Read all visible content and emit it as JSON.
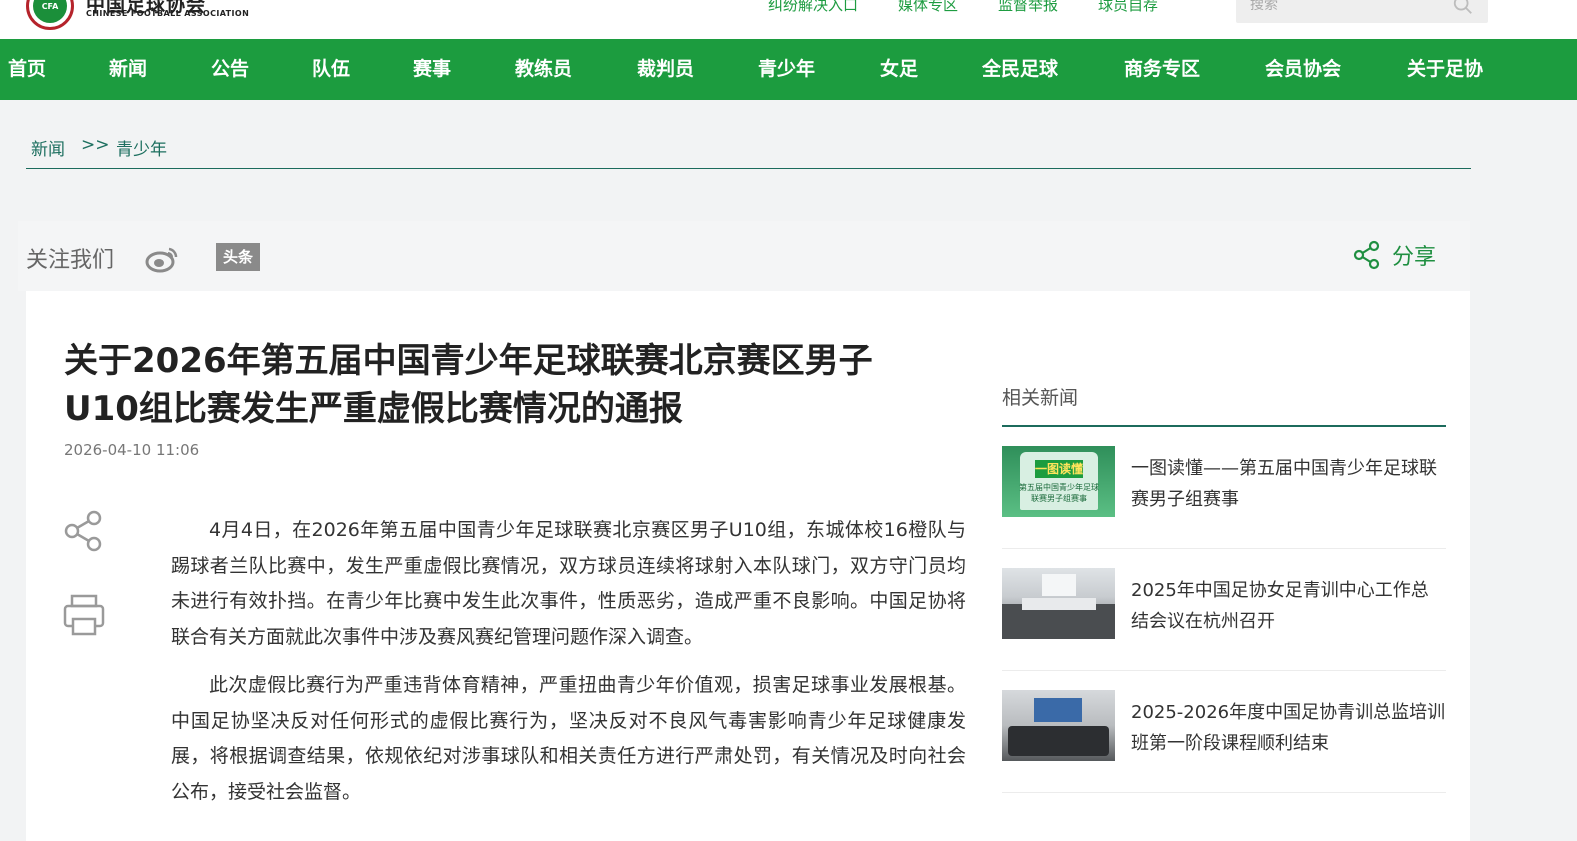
{
  "header": {
    "logo_text": "中国足球协会",
    "logo_en": "CHINESE FOOTBALL ASSOCIATION",
    "logo_badge": "CFA",
    "top_links": [
      "纠纷解决入口",
      "媒体专区",
      "监督举报",
      "球员自荐"
    ],
    "search_placeholder": "搜索"
  },
  "nav": {
    "items": [
      "首页",
      "新闻",
      "公告",
      "队伍",
      "赛事",
      "教练员",
      "裁判员",
      "青少年",
      "女足",
      "全民足球",
      "商务专区",
      "会员协会",
      "关于足协"
    ]
  },
  "breadcrumb": {
    "first": "新闻",
    "separator": ">>",
    "second": "青少年"
  },
  "follow": {
    "label": "关注我们",
    "toutiao_label": "头条",
    "share_label": "分享"
  },
  "article": {
    "title": "关于2026年第五届中国青少年足球联赛北京赛区男子U10组比赛发生严重虚假比赛情况的通报",
    "date": "2026-04-10 11:06",
    "paragraphs": [
      "4月4日，在2026年第五届中国青少年足球联赛北京赛区男子U10组，东城体校16橙队与踢球者兰队比赛中，发生严重虚假比赛情况，双方球员连续将球射入本队球门，双方守门员均未进行有效扑挡。在青少年比赛中发生此次事件，性质恶劣，造成严重不良影响。中国足协将联合有关方面就此次事件中涉及赛风赛纪管理问题作深入调查。",
      "此次虚假比赛行为严重违背体育精神，严重扭曲青少年价值观，损害足球事业发展根基。中国足协坚决反对任何形式的虚假比赛行为，坚决反对不良风气毒害影响青少年足球健康发展，将根据调查结果，依规依纪对涉事球队和相关责任方进行严肃处罚，有关情况及时向社会公布，接受社会监督。"
    ]
  },
  "related": {
    "title": "相关新闻",
    "items": [
      {
        "text": "一图读懂——第五届中国青少年足球联赛男子组赛事",
        "thumb_caption": "一图读懂",
        "thumb_sub": "第五届中国青少年足球联赛男子组赛事"
      },
      {
        "text": "2025年中国足协女足青训中心工作总结会议在杭州召开"
      },
      {
        "text": "2025-2026年度中国足协青训总监培训班第一阶段课程顺利结束"
      }
    ]
  },
  "colors": {
    "brand_green": "#1c9c3f",
    "line_teal": "#1c6b5c",
    "logo_red": "#b5232b"
  }
}
